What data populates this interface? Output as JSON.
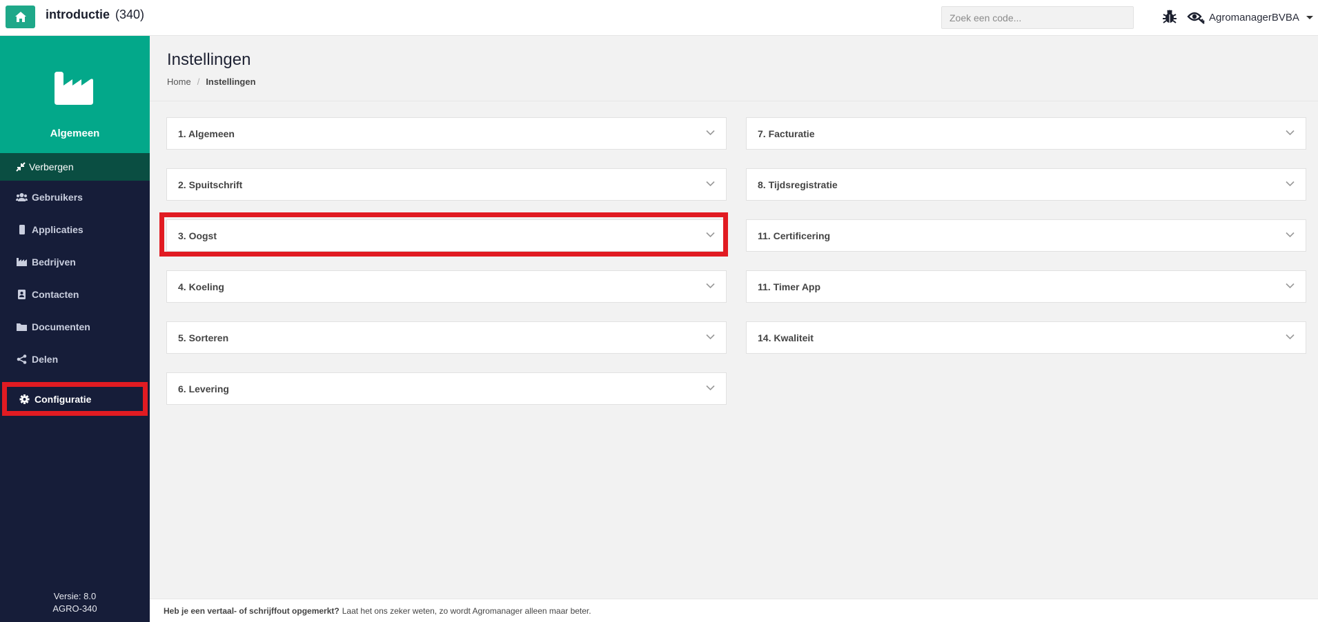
{
  "header": {
    "title": "introductie",
    "count": "(340)",
    "search_placeholder": "Zoek een code...",
    "account_name": "AgromanagerBVBA"
  },
  "sidebar": {
    "section_label": "Algemeen",
    "hide_label": "Verbergen",
    "items": [
      {
        "label": "Gebruikers",
        "icon": "users-icon"
      },
      {
        "label": "Applicaties",
        "icon": "mobile-icon"
      },
      {
        "label": "Bedrijven",
        "icon": "industry-icon"
      },
      {
        "label": "Contacten",
        "icon": "address-book-icon"
      },
      {
        "label": "Documenten",
        "icon": "folder-icon"
      },
      {
        "label": "Delen",
        "icon": "share-icon"
      },
      {
        "label": "Configuratie",
        "icon": "gear-icon",
        "active": true
      }
    ],
    "version_line1": "Versie: 8.0",
    "version_line2": "AGRO-340"
  },
  "page": {
    "title": "Instellingen",
    "breadcrumb": {
      "home": "Home",
      "separator": "/",
      "current": "Instellingen"
    }
  },
  "panels_left": [
    {
      "label": "1. Algemeen"
    },
    {
      "label": "2. Spuitschrift"
    },
    {
      "label": "3. Oogst",
      "highlighted": true
    },
    {
      "label": "4. Koeling"
    },
    {
      "label": "5. Sorteren"
    },
    {
      "label": "6. Levering"
    }
  ],
  "panels_right": [
    {
      "label": "7. Facturatie"
    },
    {
      "label": "8. Tijdsregistratie"
    },
    {
      "label": "11. Certificering"
    },
    {
      "label": "11. Timer App"
    },
    {
      "label": "14. Kwaliteit"
    }
  ],
  "footer": {
    "bold_text": "Heb je een vertaal- of schrijffout opgemerkt?",
    "text": "Laat het ons zeker weten, zo wordt Agromanager alleen maar beter."
  },
  "colors": {
    "accent": "#03a88a",
    "sidebar_bg": "#161d39",
    "highlight": "#e11b22"
  }
}
